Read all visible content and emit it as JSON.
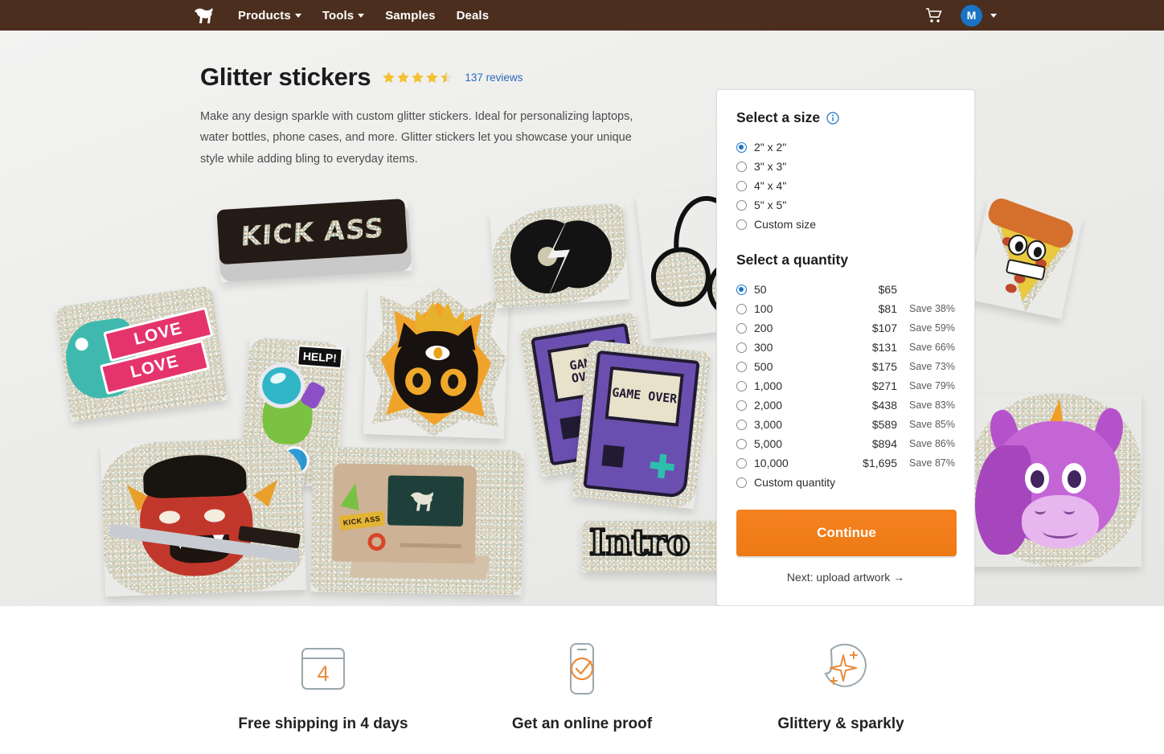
{
  "nav": {
    "logo": "horse-logo",
    "links": [
      {
        "label": "Products",
        "has_caret": true
      },
      {
        "label": "Tools",
        "has_caret": true
      },
      {
        "label": "Samples",
        "has_caret": false
      },
      {
        "label": "Deals",
        "has_caret": false
      }
    ],
    "cart_icon": "shopping-cart-icon",
    "avatar_initial": "M",
    "brand_color": "#4b2e1e",
    "avatar_color": "#1a73c4"
  },
  "product": {
    "title": "Glitter stickers",
    "rating": 4.5,
    "stars_filled": 4,
    "stars_half": 1,
    "reviews_label": "137 reviews",
    "description": "Make any design sparkle with custom glitter stickers. Ideal for personalizing laptops, water bottles, phone cases, and more. Glitter stickers let you showcase your unique style while adding bling to everyday items."
  },
  "photo": {
    "kick_ass": "KICK ASS",
    "love_line1": "LOVE",
    "love_line2": "LOVE",
    "help": "HELP!",
    "game_over_1": "GAME OVER",
    "game_over_2": "GAME OVER",
    "intro": "Intro",
    "mac_kick": "KICK ASS"
  },
  "panel": {
    "size": {
      "heading": "Select a size",
      "info_icon": "info-icon",
      "options": [
        {
          "label": "2\" x 2\"",
          "selected": true
        },
        {
          "label": "3\" x 3\"",
          "selected": false
        },
        {
          "label": "4\" x 4\"",
          "selected": false
        },
        {
          "label": "5\" x 5\"",
          "selected": false
        },
        {
          "label": "Custom size",
          "selected": false
        }
      ]
    },
    "quantity": {
      "heading": "Select a quantity",
      "options": [
        {
          "label": "50",
          "price": "$65",
          "save": "",
          "selected": true
        },
        {
          "label": "100",
          "price": "$81",
          "save": "Save 38%",
          "selected": false
        },
        {
          "label": "200",
          "price": "$107",
          "save": "Save 59%",
          "selected": false
        },
        {
          "label": "300",
          "price": "$131",
          "save": "Save 66%",
          "selected": false
        },
        {
          "label": "500",
          "price": "$175",
          "save": "Save 73%",
          "selected": false
        },
        {
          "label": "1,000",
          "price": "$271",
          "save": "Save 79%",
          "selected": false
        },
        {
          "label": "2,000",
          "price": "$438",
          "save": "Save 83%",
          "selected": false
        },
        {
          "label": "3,000",
          "price": "$589",
          "save": "Save 85%",
          "selected": false
        },
        {
          "label": "5,000",
          "price": "$894",
          "save": "Save 86%",
          "selected": false
        },
        {
          "label": "10,000",
          "price": "$1,695",
          "save": "Save 87%",
          "selected": false
        },
        {
          "label": "Custom quantity",
          "price": "",
          "save": "",
          "selected": false
        }
      ]
    },
    "cta_label": "Continue",
    "cta_color": "#f58220",
    "next_step": "Next: upload artwork →"
  },
  "features": [
    {
      "icon": "calendar-4-icon",
      "badge": "4",
      "label": "Free shipping in 4 days"
    },
    {
      "icon": "phone-check-icon",
      "label": "Get an online proof"
    },
    {
      "icon": "sticker-sparkle-icon",
      "label": "Glittery & sparkly"
    }
  ],
  "footer": {
    "accent_color": "#44664a"
  }
}
